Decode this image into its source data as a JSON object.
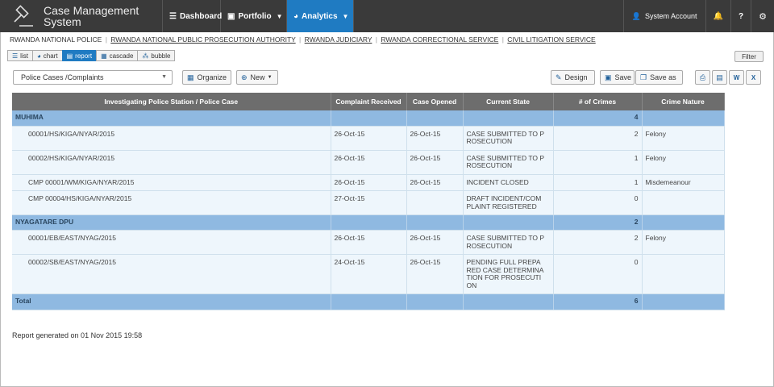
{
  "app": {
    "title": "Case Management System"
  },
  "nav": {
    "dashboard": "Dashboard",
    "portfolio": "Portfolio",
    "analytics": "Analytics",
    "account": "System Account"
  },
  "orgs": [
    "RWANDA NATIONAL POLICE",
    "RWANDA NATIONAL PUBLIC PROSECUTION AUTHORITY",
    "RWANDA JUDICIARY",
    "RWANDA CORRECTIONAL SERVICE",
    "CIVIL LITIGATION SERVICE"
  ],
  "views": [
    "list",
    "chart",
    "report",
    "cascade",
    "bubble"
  ],
  "active_view": "report",
  "toolbar": {
    "filter": "Filter",
    "report_name": "Police Cases /Complaints",
    "organize": "Organize",
    "new": "New",
    "design": "Design",
    "save": "Save",
    "save_as": "Save as"
  },
  "table": {
    "headers": [
      "Investigating Police Station / Police Case",
      "Complaint Received",
      "Case Opened",
      "Current State",
      "# of Crimes",
      "Crime Nature"
    ],
    "groups": [
      {
        "name": "MUHIMA",
        "crimes": "4",
        "rows": [
          {
            "case": "00001/HS/KIGA/NYAR/2015",
            "received": "26-Oct-15",
            "opened": "26-Oct-15",
            "state": "CASE SUBMITTED TO P ROSECUTION",
            "crimes": "2",
            "nature": "Felony"
          },
          {
            "case": "00002/HS/KIGA/NYAR/2015",
            "received": "26-Oct-15",
            "opened": "26-Oct-15",
            "state": "CASE SUBMITTED TO P ROSECUTION",
            "crimes": "1",
            "nature": "Felony"
          },
          {
            "case": "CMP 00001/WM/KIGA/NYAR/2015",
            "received": "26-Oct-15",
            "opened": "26-Oct-15",
            "state": "INCIDENT CLOSED",
            "crimes": "1",
            "nature": "Misdemeanour"
          },
          {
            "case": "CMP 00004/HS/KIGA/NYAR/2015",
            "received": "27-Oct-15",
            "opened": "",
            "state": "DRAFT INCIDENT/COM PLAINT REGISTERED",
            "crimes": "0",
            "nature": ""
          }
        ]
      },
      {
        "name": "NYAGATARE DPU",
        "crimes": "2",
        "rows": [
          {
            "case": "00001/EB/EAST/NYAG/2015",
            "received": "26-Oct-15",
            "opened": "26-Oct-15",
            "state": "CASE SUBMITTED TO P ROSECUTION",
            "crimes": "2",
            "nature": "Felony"
          },
          {
            "case": "00002/SB/EAST/NYAG/2015",
            "received": "24-Oct-15",
            "opened": "26-Oct-15",
            "state": "PENDING FULL PREPA RED CASE DETERMINA TION FOR PROSECUTI ON",
            "crimes": "0",
            "nature": ""
          }
        ]
      }
    ],
    "total_label": "Total",
    "total_crimes": "6"
  },
  "footer": "Report generated on 01 Nov 2015 19:58"
}
